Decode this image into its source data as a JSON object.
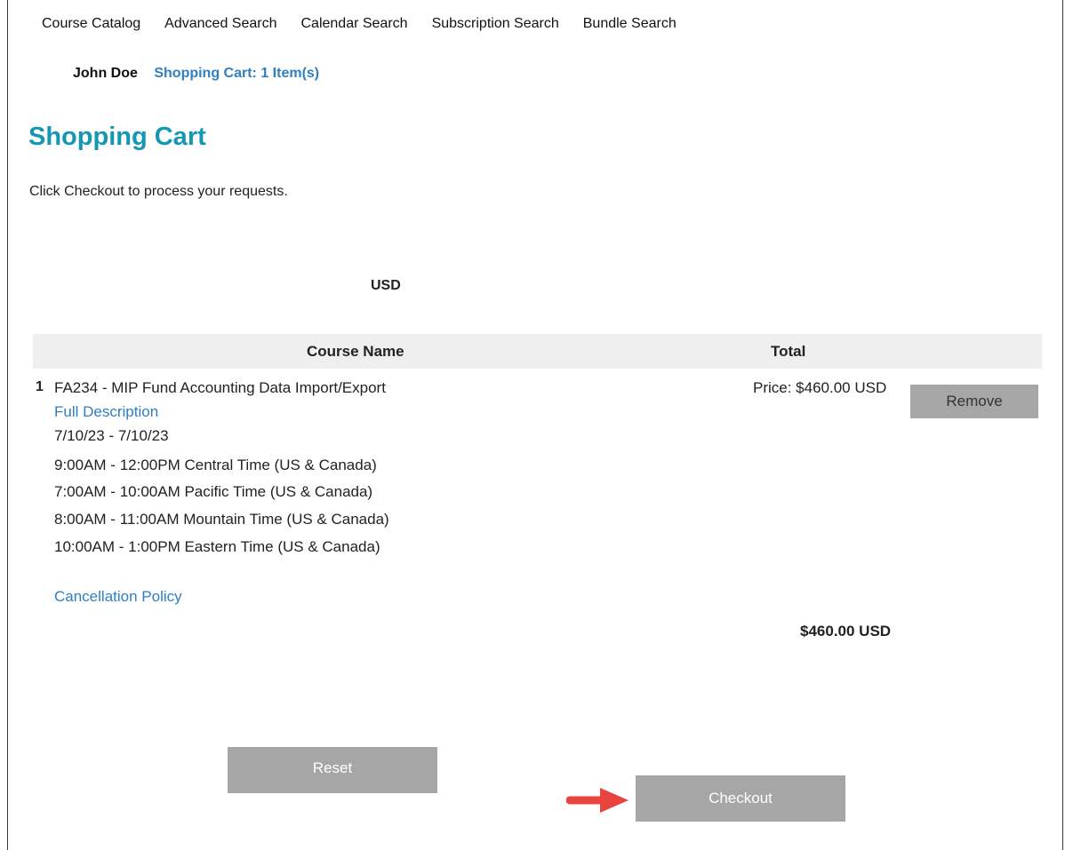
{
  "nav": {
    "items": [
      {
        "label": "Course Catalog"
      },
      {
        "label": "Advanced Search"
      },
      {
        "label": "Calendar Search"
      },
      {
        "label": "Subscription Search"
      },
      {
        "label": "Bundle Search"
      }
    ]
  },
  "user": {
    "name": "John Doe",
    "cart_link": "Shopping Cart: 1 Item(s)"
  },
  "page": {
    "title": "Shopping Cart",
    "intro": "Click Checkout to process your requests.",
    "currency": "USD"
  },
  "table": {
    "headers": {
      "course_name": "Course Name",
      "total": "Total"
    },
    "rows": [
      {
        "number": "1",
        "course": "FA234 - MIP Fund Accounting Data Import/Export",
        "full_description": "Full Description",
        "dates": "7/10/23 - 7/10/23",
        "times": [
          "9:00AM - 12:00PM Central Time (US & Canada)",
          "7:00AM - 10:00AM Pacific Time (US & Canada)",
          "8:00AM - 11:00AM Mountain Time (US & Canada)",
          "10:00AM - 1:00PM Eastern Time (US & Canada)"
        ],
        "cancellation_policy": "Cancellation Policy",
        "price": "Price: $460.00 USD",
        "remove_label": "Remove"
      }
    ],
    "grand_total": "$460.00 USD"
  },
  "actions": {
    "reset_label": "Reset",
    "checkout_label": "Checkout"
  },
  "colors": {
    "title": "#1596b3",
    "link": "#2f7fc1",
    "button": "#a6a6a6",
    "header_bg": "#efefef",
    "arrow": "#e8433c"
  },
  "icons": {
    "checkout_pointer": "red-arrow-right-icon"
  }
}
